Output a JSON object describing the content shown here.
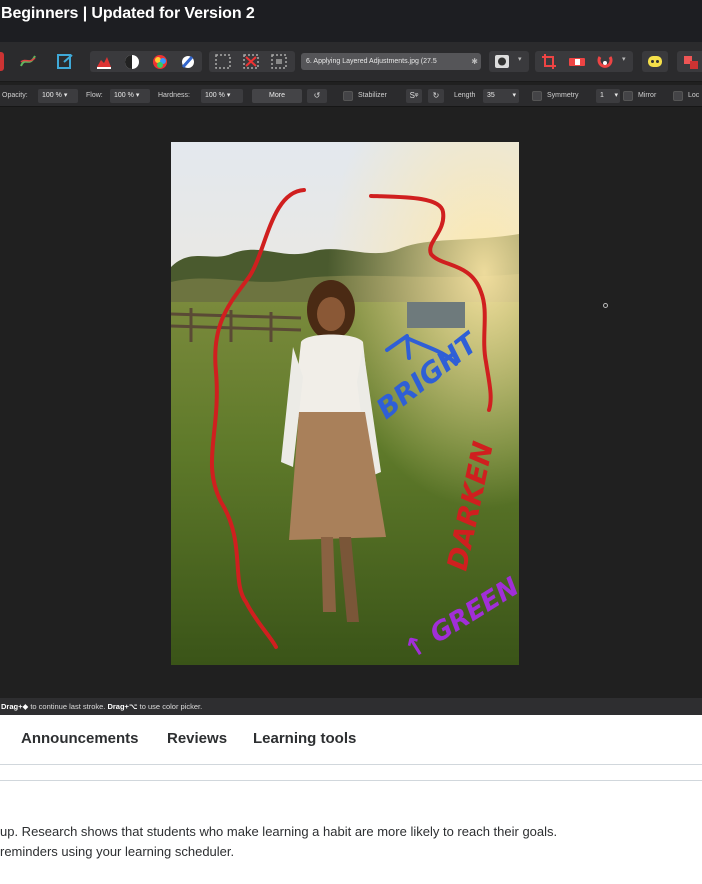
{
  "course": {
    "title": "Beginners | Updated for Version 2"
  },
  "app": {
    "document_tab": "6. Applying Layered Adjustments.jpg (27.5",
    "context_toolbar": {
      "opacity_label": "Opacity:",
      "opacity_value": "100 %",
      "flow_label": "Flow:",
      "flow_value": "100 %",
      "hardness_label": "Hardness:",
      "hardness_value": "100 %",
      "more_label": "More",
      "stabilizer_label": "Stabilizer",
      "length_label": "Length",
      "length_value": "35",
      "symmetry_label": "Symmetry",
      "symmetry_value": "1",
      "mirror_label": "Mirror",
      "lock_label": "Loc"
    },
    "canvas_annotations": {
      "bright": "BRIGHT",
      "darken": "DARKEN",
      "green": "↑ GREEN"
    },
    "status": {
      "drag1": "Drag+◆",
      "text1": " to continue last stroke. ",
      "drag2": "Drag+⌥",
      "text2": " to use color picker."
    }
  },
  "tabs": [
    {
      "label": "Announcements"
    },
    {
      "label": "Reviews"
    },
    {
      "label": "Learning tools"
    }
  ],
  "reminder": {
    "line1": "up. Research shows that students who make learning a habit are more likely to reach their goals.",
    "line2": "reminders using your learning scheduler."
  },
  "colors": {
    "stroke_red": "#d01f1f",
    "stroke_blue": "#2f5fd6",
    "stroke_purple": "#a12ed8"
  }
}
